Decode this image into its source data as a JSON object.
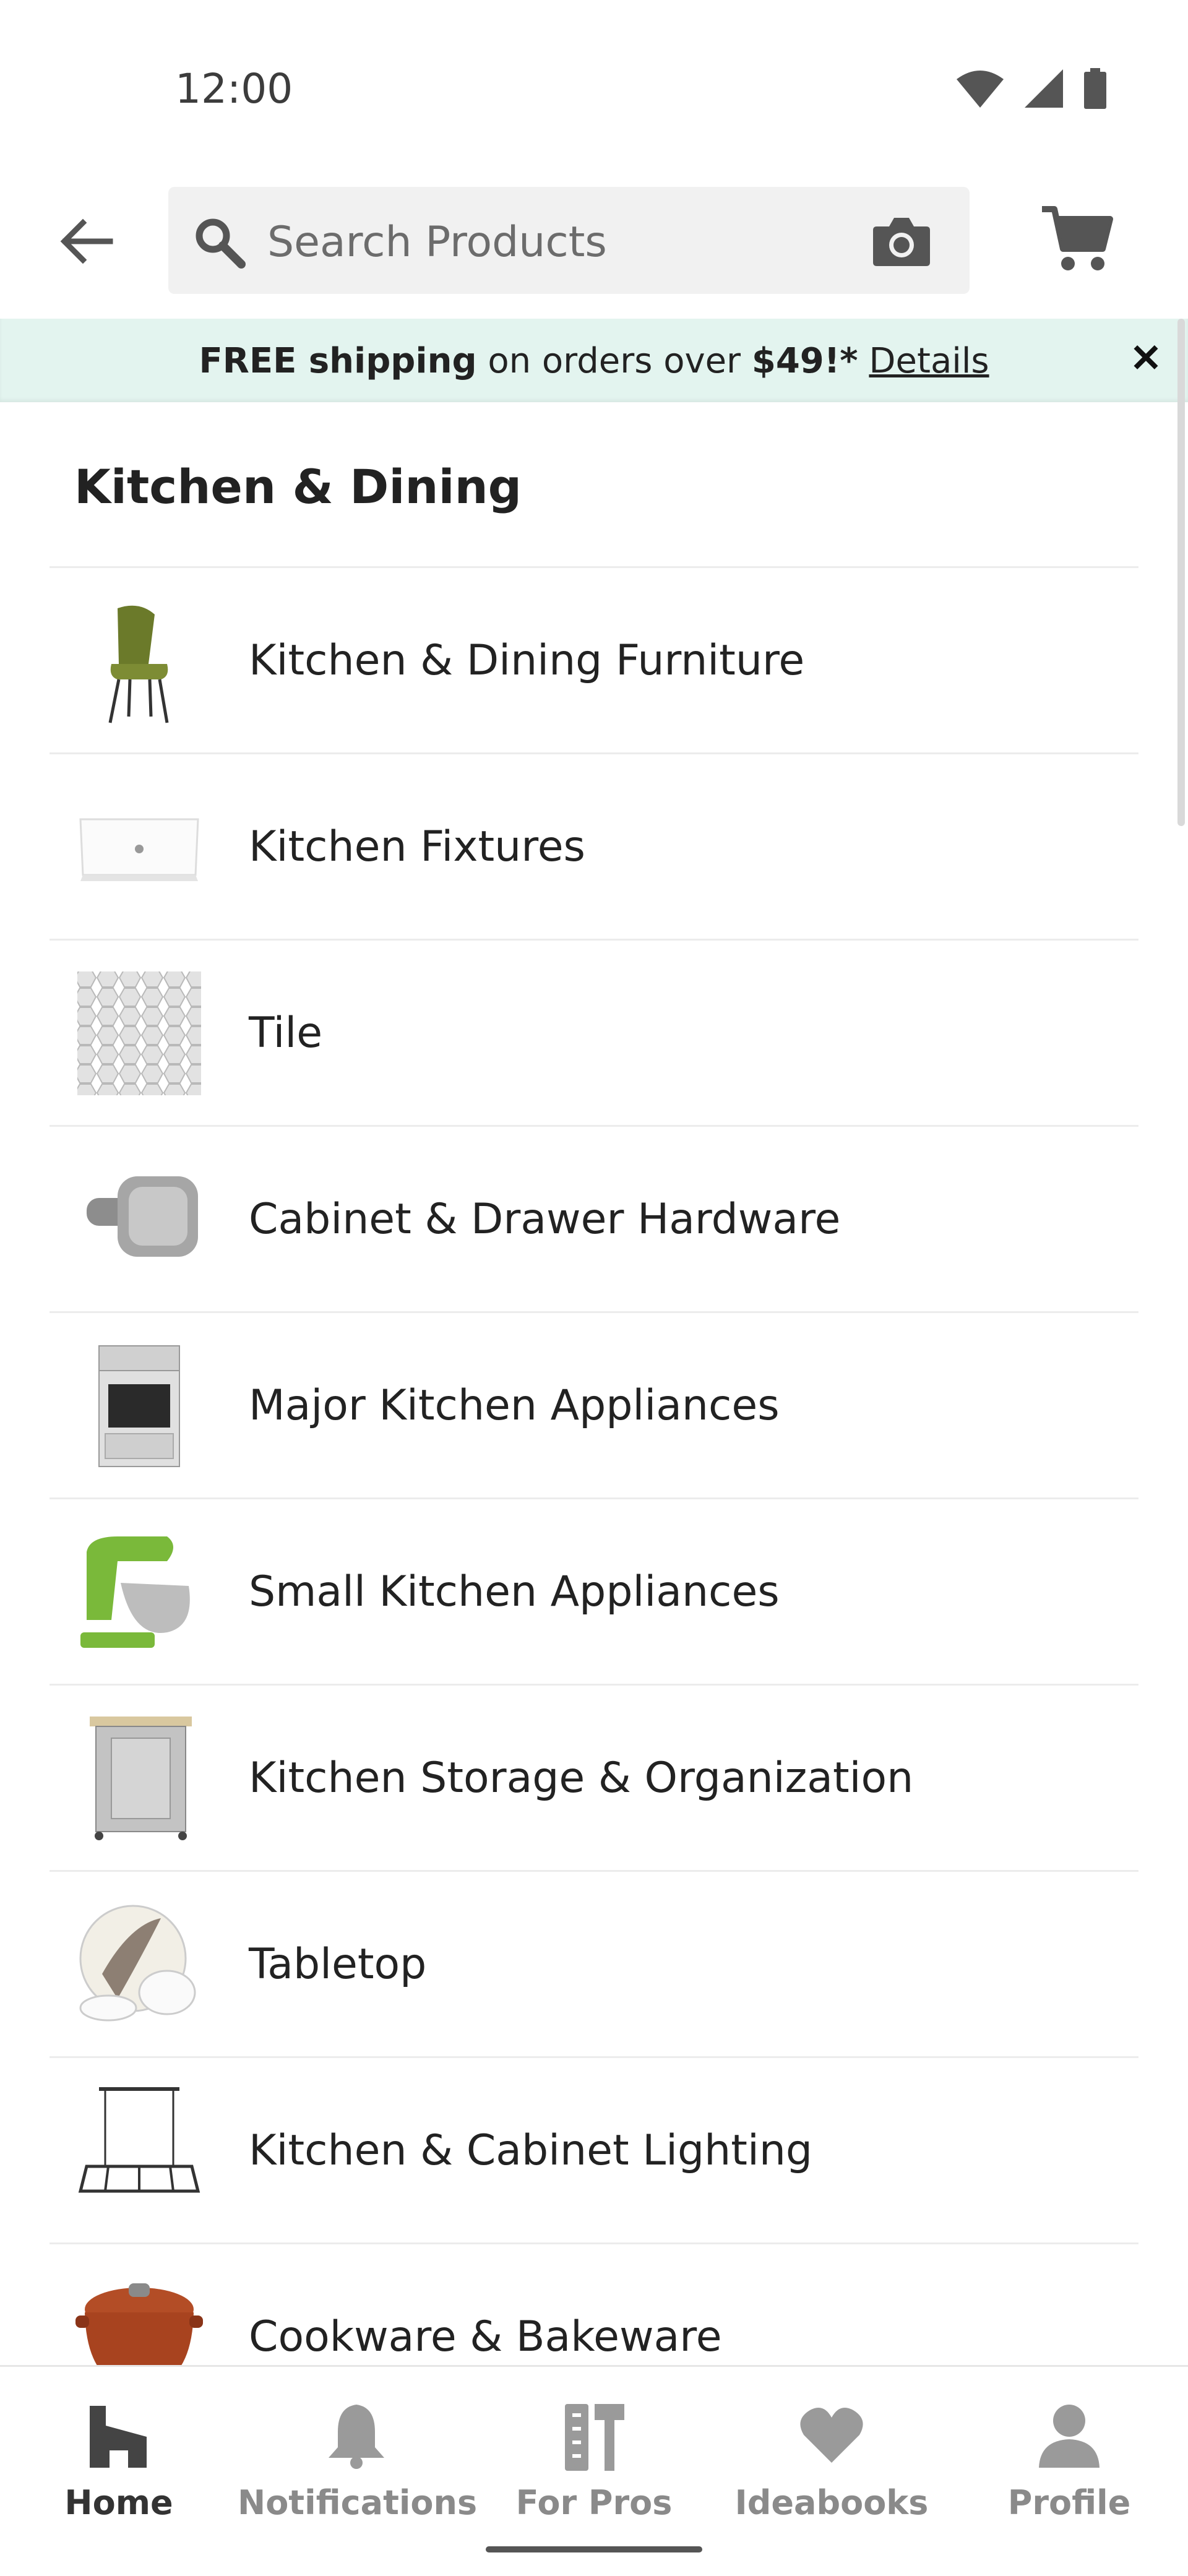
{
  "status_bar": {
    "time": "12:00",
    "icons": [
      "wifi-icon",
      "cellular-signal-icon",
      "battery-icon"
    ]
  },
  "app_bar": {
    "back_icon": "arrow-left-icon",
    "search": {
      "placeholder": "Search Products",
      "value": "",
      "icon": "search-icon",
      "camera_icon": "camera-icon"
    },
    "cart_icon": "cart-icon"
  },
  "promo": {
    "bold_lead": "FREE shipping",
    "middle": " on orders over ",
    "bold_amount": "$49!*",
    "link": "Details",
    "close": "✕",
    "background": "#e3f4ef"
  },
  "section": {
    "title": "Kitchen & Dining"
  },
  "categories": [
    {
      "label": "Kitchen & Dining Furniture",
      "thumb": "chair"
    },
    {
      "label": "Kitchen Fixtures",
      "thumb": "sink"
    },
    {
      "label": "Tile",
      "thumb": "tile"
    },
    {
      "label": "Cabinet & Drawer Hardware",
      "thumb": "knob"
    },
    {
      "label": "Major Kitchen Appliances",
      "thumb": "range"
    },
    {
      "label": "Small Kitchen Appliances",
      "thumb": "mixer"
    },
    {
      "label": "Kitchen Storage & Organization",
      "thumb": "cart"
    },
    {
      "label": "Tabletop",
      "thumb": "dishes"
    },
    {
      "label": "Kitchen & Cabinet Lighting",
      "thumb": "pendant"
    },
    {
      "label": "Cookware & Bakeware",
      "thumb": "pot"
    }
  ],
  "bottom_nav": [
    {
      "label": "Home",
      "icon": "home-icon",
      "active": true
    },
    {
      "label": "Notifications",
      "icon": "bell-icon",
      "active": false
    },
    {
      "label": "For Pros",
      "icon": "tools-icon",
      "active": false
    },
    {
      "label": "Ideabooks",
      "icon": "heart-icon",
      "active": false
    },
    {
      "label": "Profile",
      "icon": "person-icon",
      "active": false
    }
  ],
  "colors": {
    "active_nav": "#333333",
    "inactive_nav": "#8a8a8a",
    "accent": "#e3f4ef"
  }
}
